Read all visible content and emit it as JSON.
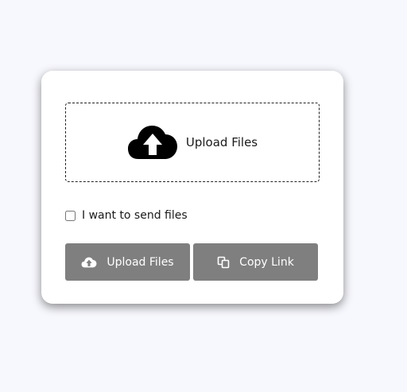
{
  "dropzone": {
    "icon": "cloud-upload-icon",
    "label": "Upload Files"
  },
  "consent": {
    "label": "I want to send files",
    "checked": false
  },
  "buttons": {
    "upload": {
      "icon": "cloud-upload-icon",
      "label": "Upload Files"
    },
    "copy": {
      "icon": "copy-icon",
      "label": "Copy Link"
    }
  },
  "colors": {
    "page_background": "#f7f8fd",
    "card_background": "#ffffff",
    "button_background": "#7f7f7f",
    "button_text": "#ffffff"
  }
}
